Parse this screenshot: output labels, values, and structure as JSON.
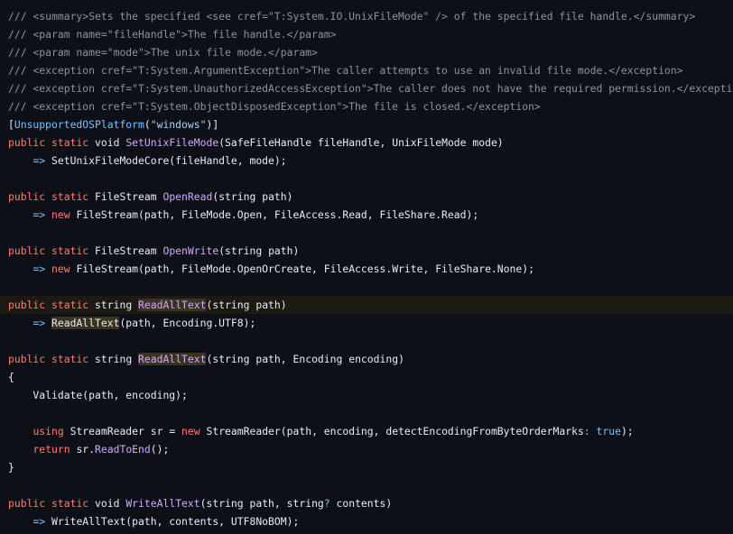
{
  "colors": {
    "background": "#0d1117",
    "comment": "#8b949e",
    "keyword": "#ff7b72",
    "function": "#d2a8ff",
    "attribute": "#79c0ff",
    "string": "#a5d6ff",
    "plain": "#e6edf3",
    "current_line": "#1c1a13",
    "word_highlight": "#3a3320"
  },
  "current_line_index": 16,
  "lines": [
    [
      [
        "c",
        "/// <summary>Sets the specified <see cref=\"T:System.IO.UnixFileMode\" /> of the specified file handle.</summary>"
      ]
    ],
    [
      [
        "c",
        "/// <param name=\"fileHandle\">The file handle.</param>"
      ]
    ],
    [
      [
        "c",
        "/// <param name=\"mode\">The unix file mode.</param>"
      ]
    ],
    [
      [
        "c",
        "/// <exception cref=\"T:System.ArgumentException\">The caller attempts to use an invalid file mode.</exception>"
      ]
    ],
    [
      [
        "c",
        "/// <exception cref=\"T:System.UnauthorizedAccessException\">The caller does not have the required permission.</exception>"
      ]
    ],
    [
      [
        "c",
        "/// <exception cref=\"T:System.ObjectDisposedException\">The file is closed.</exception>"
      ]
    ],
    [
      [
        "p",
        "["
      ],
      [
        "a",
        "UnsupportedOSPlatform"
      ],
      [
        "p",
        "("
      ],
      [
        "s",
        "\"windows\""
      ],
      [
        "p",
        ")]"
      ]
    ],
    [
      [
        "k",
        "public"
      ],
      [
        "p",
        " "
      ],
      [
        "k",
        "static"
      ],
      [
        "p",
        " void "
      ],
      [
        "f",
        "SetUnixFileMode"
      ],
      [
        "p",
        "(SafeFileHandle fileHandle, UnixFileMode mode)"
      ]
    ],
    [
      [
        "p",
        "    "
      ],
      [
        "o",
        "=>"
      ],
      [
        "p",
        " SetUnixFileModeCore(fileHandle, mode);"
      ]
    ],
    [],
    [
      [
        "k",
        "public"
      ],
      [
        "p",
        " "
      ],
      [
        "k",
        "static"
      ],
      [
        "p",
        " FileStream "
      ],
      [
        "f",
        "OpenRead"
      ],
      [
        "p",
        "(string path)"
      ]
    ],
    [
      [
        "p",
        "    "
      ],
      [
        "o",
        "=>"
      ],
      [
        "p",
        " "
      ],
      [
        "k",
        "new"
      ],
      [
        "p",
        " FileStream(path, FileMode.Open, FileAccess.Read, FileShare.Read);"
      ]
    ],
    [],
    [
      [
        "k",
        "public"
      ],
      [
        "p",
        " "
      ],
      [
        "k",
        "static"
      ],
      [
        "p",
        " FileStream "
      ],
      [
        "f",
        "OpenWrite"
      ],
      [
        "p",
        "(string path)"
      ]
    ],
    [
      [
        "p",
        "    "
      ],
      [
        "o",
        "=>"
      ],
      [
        "p",
        " "
      ],
      [
        "k",
        "new"
      ],
      [
        "p",
        " FileStream(path, FileMode.OpenOrCreate, FileAccess.Write, FileShare.None);"
      ]
    ],
    [],
    [
      [
        "k",
        "public"
      ],
      [
        "p",
        " "
      ],
      [
        "k",
        "static"
      ],
      [
        "p",
        " string "
      ],
      [
        "fh",
        "ReadAllText"
      ],
      [
        "p",
        "(string path)"
      ]
    ],
    [
      [
        "p",
        "    "
      ],
      [
        "o",
        "=>"
      ],
      [
        "p",
        " "
      ],
      [
        "ph",
        "ReadAllText"
      ],
      [
        "p",
        "(path, Encoding.UTF8);"
      ]
    ],
    [],
    [
      [
        "k",
        "public"
      ],
      [
        "p",
        " "
      ],
      [
        "k",
        "static"
      ],
      [
        "p",
        " string "
      ],
      [
        "fh",
        "ReadAllText"
      ],
      [
        "p",
        "(string path, Encoding encoding)"
      ]
    ],
    [
      [
        "p",
        "{"
      ]
    ],
    [
      [
        "p",
        "    Validate(path, encoding);"
      ]
    ],
    [],
    [
      [
        "p",
        "    "
      ],
      [
        "k",
        "using"
      ],
      [
        "p",
        " StreamReader sr = "
      ],
      [
        "k",
        "new"
      ],
      [
        "p",
        " StreamReader(path, encoding, detectEncodingFromByteOrderMarks"
      ],
      [
        "o",
        ":"
      ],
      [
        "p",
        " "
      ],
      [
        "n",
        "true"
      ],
      [
        "p",
        ");"
      ]
    ],
    [
      [
        "p",
        "    "
      ],
      [
        "k",
        "return"
      ],
      [
        "p",
        " sr."
      ],
      [
        "f",
        "ReadToEnd"
      ],
      [
        "p",
        "();"
      ]
    ],
    [
      [
        "p",
        "}"
      ]
    ],
    [],
    [
      [
        "k",
        "public"
      ],
      [
        "p",
        " "
      ],
      [
        "k",
        "static"
      ],
      [
        "p",
        " void "
      ],
      [
        "f",
        "WriteAllText"
      ],
      [
        "p",
        "(string path, string"
      ],
      [
        "o",
        "?"
      ],
      [
        "p",
        " contents)"
      ]
    ],
    [
      [
        "p",
        "    "
      ],
      [
        "o",
        "=>"
      ],
      [
        "p",
        " WriteAllText(path, contents, UTF8NoBOM);"
      ]
    ]
  ]
}
